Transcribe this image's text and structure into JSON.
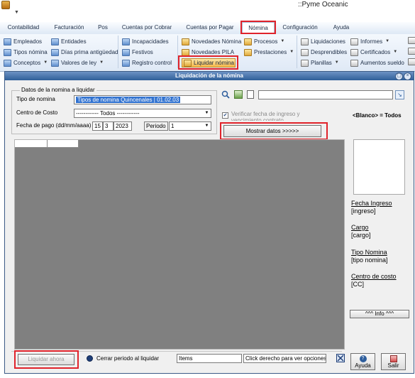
{
  "app": {
    "title": "::Pyme Oceanic"
  },
  "tabs": [
    {
      "label": "Contabilidad"
    },
    {
      "label": "Facturación"
    },
    {
      "label": "Pos"
    },
    {
      "label": "Cuentas por Cobrar"
    },
    {
      "label": "Cuentas por Pagar"
    },
    {
      "label": "Nómina"
    },
    {
      "label": "Configuración"
    },
    {
      "label": "Ayuda"
    }
  ],
  "ribbon": {
    "empleados": "Empleados",
    "tipos_nomina": "Tipos nómina",
    "conceptos": "Conceptos",
    "entidades": "Entidades",
    "dias_prima": "Días prima antigüedad",
    "valores_ley": "Valores de ley",
    "incapacidades": "Incapacidades",
    "festivos": "Festivos",
    "registro_control": "Registro control",
    "novedades_nomina": "Novedades Nómina",
    "novedades_pila": "Novedades PILA",
    "liquidar_nomina": "Liquidar nómina",
    "procesos": "Procesos",
    "prestaciones": "Prestaciones",
    "liquidaciones": "Liquidaciones",
    "desprendibles": "Desprendibles",
    "planillas": "Planillas",
    "informes": "Informes",
    "certificados": "Certificados",
    "aumentos_sueldo": "Aumentos sueldo"
  },
  "dialog": {
    "title": "Liquidación de la nómina",
    "group_label": "Datos de la nomina a liquidar",
    "tipo_nomina_label": "Tipo de nomina",
    "tipo_nomina_value": "Tipos de nomina Quincenales | 01.02.03",
    "centro_costo_label": "Centro de Costo",
    "centro_costo_value": "------------ Todos ------------",
    "fecha_label": "Fecha de pago (dd/mm/aaaa)",
    "fecha_dd": "15",
    "fecha_mm": "3",
    "fecha_aaaa": "2023",
    "periodo_label": "Periodo",
    "periodo_value": "1",
    "verificar_label": "Verificar fecha de ingreso y vencimiento contrato",
    "blanco_label": "<Blanco> = Todos",
    "mostrar_datos": "Mostrar datos  >>>>>",
    "fecha_ingreso_label": "Fecha Ingreso",
    "fecha_ingreso_value": "[ingreso]",
    "cargo_label": "Cargo",
    "cargo_value": "[cargo]",
    "tipo_nomina_info_label": "Tipo Nomina",
    "tipo_nomina_info_value": "[tipo nomina]",
    "centro_costo_info_label": "Centro de costo",
    "centro_costo_info_value": "[CC]",
    "info_button": "^^^ Info ^^^",
    "liquidar_ahora": "Liquidar ahora",
    "cerrar_periodo": "Cerrar periodo al liquidar",
    "items_label": "Items",
    "click_derecho": "Click derecho para ver opciones",
    "ayuda": "Ayuda",
    "salir": "Salir"
  },
  "colors": {
    "highlight_red": "#e0232b",
    "title_blue": "#2f5f99",
    "grid_gray": "#808080"
  }
}
